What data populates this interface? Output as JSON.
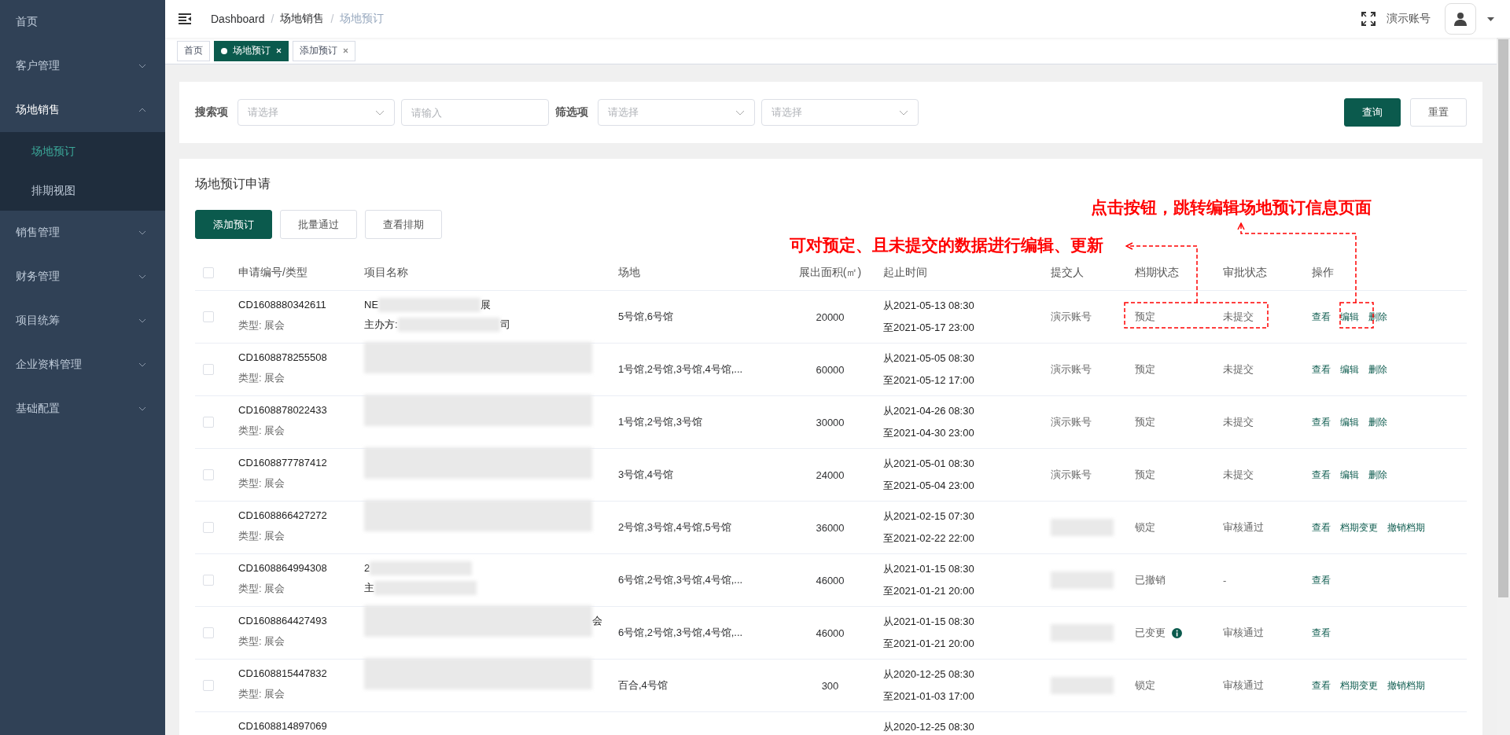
{
  "sidebar": {
    "items": [
      {
        "label": "首页",
        "kind": "link",
        "expanded": false
      },
      {
        "label": "客户管理",
        "kind": "group",
        "expanded": false
      },
      {
        "label": "场地销售",
        "kind": "group",
        "expanded": true,
        "children": [
          {
            "label": "场地预订",
            "selected": true
          },
          {
            "label": "排期视图",
            "selected": false
          }
        ]
      },
      {
        "label": "销售管理",
        "kind": "group",
        "expanded": false
      },
      {
        "label": "财务管理",
        "kind": "group",
        "expanded": false
      },
      {
        "label": "项目统筹",
        "kind": "group",
        "expanded": false
      },
      {
        "label": "企业资料管理",
        "kind": "group",
        "expanded": false
      },
      {
        "label": "基础配置",
        "kind": "group",
        "expanded": false
      }
    ]
  },
  "header": {
    "breadcrumb": [
      "Dashboard",
      "场地销售",
      "场地预订"
    ],
    "separator": "/",
    "account": "演示账号"
  },
  "tabs": [
    {
      "label": "首页",
      "selected": false,
      "closable": false
    },
    {
      "label": "场地预订",
      "selected": true,
      "closable": true
    },
    {
      "label": "添加预订",
      "selected": false,
      "closable": true
    }
  ],
  "search": {
    "label": "搜索项",
    "select_placeholder": "请选择",
    "input_placeholder": "请输入",
    "filter_label": "筛选项",
    "filter_placeholders": [
      "请选择",
      "请选择"
    ],
    "buttons": [
      {
        "label": "查询",
        "kind": "primary"
      },
      {
        "label": "重置",
        "kind": "default"
      }
    ]
  },
  "panel": {
    "title": "场地预订申请",
    "buttons": [
      {
        "label": "添加预订",
        "kind": "primary"
      },
      {
        "label": "批量通过",
        "kind": "default"
      },
      {
        "label": "查看排期",
        "kind": "default"
      }
    ]
  },
  "table": {
    "select_all_checked": false,
    "columns": [
      "申请编号/类型",
      "项目名称",
      "场地",
      "展出面积(㎡)",
      "起止时间",
      "提交人",
      "档期状态",
      "审批状态",
      "操作"
    ],
    "rows": [
      {
        "checked": false,
        "id": "CD1608880342611",
        "type": "类型: 展会",
        "project": [
          [
            {
              "kind": "text",
              "text": "NE"
            },
            {
              "kind": "redacted"
            },
            {
              "kind": "text",
              "text": "展"
            }
          ],
          [
            {
              "kind": "text",
              "text": "主办方:"
            },
            {
              "kind": "redacted"
            },
            {
              "kind": "text",
              "text": "司"
            }
          ]
        ],
        "venue": "5号馆,6号馆",
        "area": "20000",
        "from": "从2021-05-13 08:30",
        "to": "至2021-05-17 23:00",
        "submitter": {
          "kind": "text",
          "text": "演示账号"
        },
        "schedule": "预定",
        "schedule_info": false,
        "approval": "未提交",
        "ops": [
          "查看",
          "编辑",
          "删除"
        ]
      },
      {
        "checked": false,
        "id": "CD1608878255508",
        "type": "类型: 展会",
        "project": [
          [
            {
              "kind": "block"
            }
          ]
        ],
        "venue": "1号馆,2号馆,3号馆,4号馆,...",
        "area": "60000",
        "from": "从2021-05-05 08:30",
        "to": "至2021-05-12 17:00",
        "submitter": {
          "kind": "text",
          "text": "演示账号"
        },
        "schedule": "预定",
        "schedule_info": false,
        "approval": "未提交",
        "ops": [
          "查看",
          "编辑",
          "删除"
        ]
      },
      {
        "checked": false,
        "id": "CD1608878022433",
        "type": "类型: 展会",
        "project": [
          [
            {
              "kind": "block"
            }
          ]
        ],
        "venue": "1号馆,2号馆,3号馆",
        "area": "30000",
        "from": "从2021-04-26 08:30",
        "to": "至2021-04-30 23:00",
        "submitter": {
          "kind": "text",
          "text": "演示账号"
        },
        "schedule": "预定",
        "schedule_info": false,
        "approval": "未提交",
        "ops": [
          "查看",
          "编辑",
          "删除"
        ]
      },
      {
        "checked": false,
        "id": "CD1608877787412",
        "type": "类型: 展会",
        "project": [
          [
            {
              "kind": "block"
            }
          ]
        ],
        "venue": "3号馆,4号馆",
        "area": "24000",
        "from": "从2021-05-01 08:30",
        "to": "至2021-05-04 23:00",
        "submitter": {
          "kind": "text",
          "text": "演示账号"
        },
        "schedule": "预定",
        "schedule_info": false,
        "approval": "未提交",
        "ops": [
          "查看",
          "编辑",
          "删除"
        ]
      },
      {
        "checked": false,
        "id": "CD1608866427272",
        "type": "类型: 展会",
        "project": [
          [
            {
              "kind": "block"
            }
          ]
        ],
        "venue": "2号馆,3号馆,4号馆,5号馆",
        "area": "36000",
        "from": "从2021-02-15 07:30",
        "to": "至2021-02-22 22:00",
        "submitter": {
          "kind": "redacted"
        },
        "schedule": "锁定",
        "schedule_info": false,
        "approval": "审核通过",
        "ops": [
          "查看",
          "档期变更",
          "撤销档期"
        ]
      },
      {
        "checked": false,
        "id": "CD1608864994308",
        "type": "类型: 展会",
        "project": [
          [
            {
              "kind": "text",
              "text": "2"
            },
            {
              "kind": "redacted"
            }
          ],
          [
            {
              "kind": "text",
              "text": "主"
            },
            {
              "kind": "redacted"
            }
          ]
        ],
        "venue": "6号馆,2号馆,3号馆,4号馆,...",
        "area": "46000",
        "from": "从2021-01-15 08:30",
        "to": "至2021-01-21 20:00",
        "submitter": {
          "kind": "redacted"
        },
        "schedule": "已撤销",
        "schedule_info": false,
        "approval": "-",
        "ops": [
          "查看"
        ]
      },
      {
        "checked": false,
        "id": "CD1608864427493",
        "type": "类型: 展会",
        "project": [
          [
            {
              "kind": "block"
            },
            {
              "kind": "text",
              "text": "会"
            }
          ]
        ],
        "venue": "6号馆,2号馆,3号馆,4号馆,...",
        "area": "46000",
        "from": "从2021-01-15 08:30",
        "to": "至2021-01-21 20:00",
        "submitter": {
          "kind": "redacted"
        },
        "schedule": "已变更",
        "schedule_info": true,
        "approval": "审核通过",
        "ops": [
          "查看"
        ]
      },
      {
        "checked": false,
        "id": "CD1608815447832",
        "type": "类型: 展会",
        "project": [
          [
            {
              "kind": "block"
            }
          ]
        ],
        "venue": "百合,4号馆",
        "area": "300",
        "from": "从2020-12-25 08:30",
        "to": "至2021-01-03 17:00",
        "submitter": {
          "kind": "redacted"
        },
        "schedule": "锁定",
        "schedule_info": false,
        "approval": "审核通过",
        "ops": [
          "查看",
          "档期变更",
          "撤销档期"
        ]
      },
      {
        "id": "CD1608814897069",
        "from": "从2020-12-25 08:30",
        "ops": []
      }
    ]
  },
  "annotations": [
    {
      "text": "点击按钮，跳转编辑场地预订信息页面"
    },
    {
      "text": "可对预定、且未提交的数据进行编辑、更新"
    }
  ]
}
